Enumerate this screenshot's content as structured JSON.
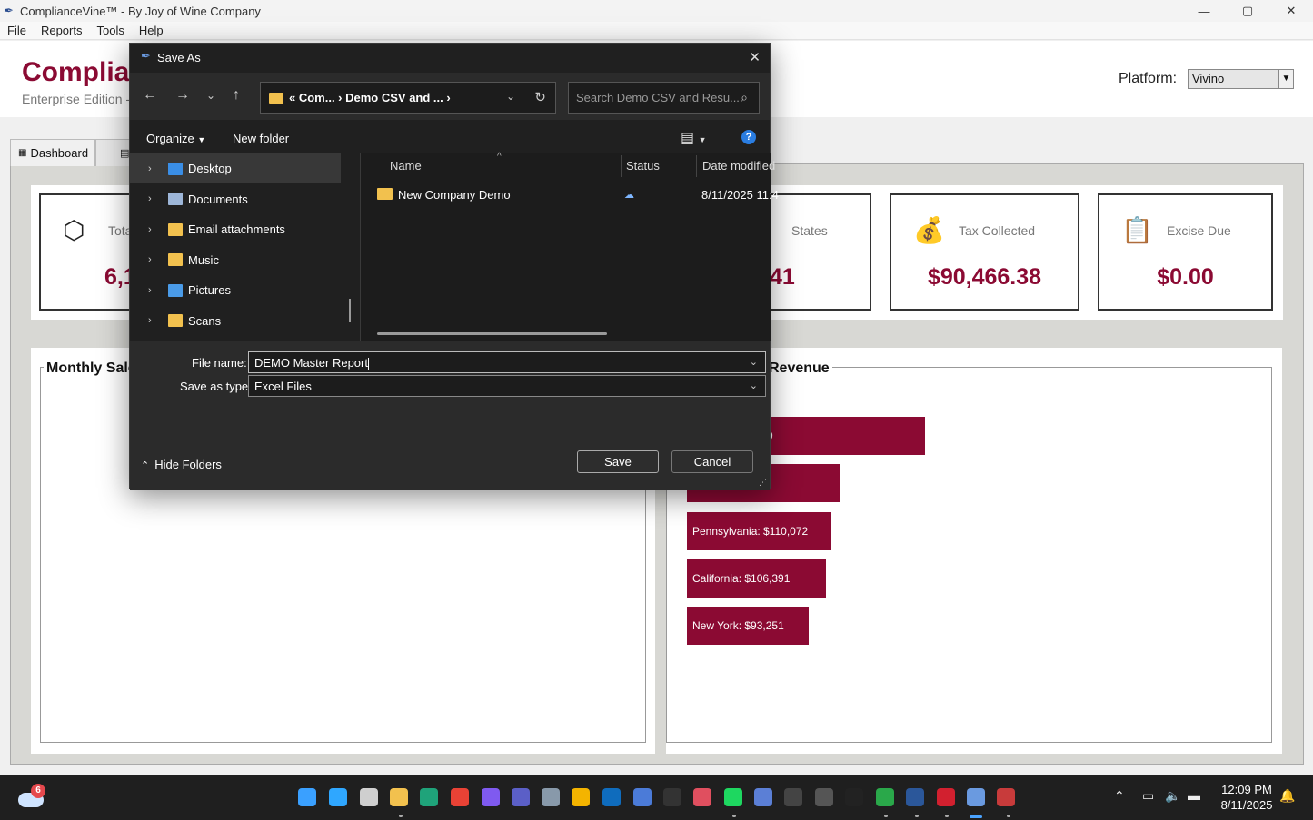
{
  "window": {
    "title": "ComplianceVine™ - By Joy of Wine Company",
    "minimize": "—",
    "maximize": "▢",
    "close": "✕"
  },
  "menu": [
    "File",
    "Reports",
    "Tools",
    "Help"
  ],
  "header": {
    "brand": "Complian",
    "edition": "Enterprise Edition -",
    "platform_label": "Platform:",
    "platform_value": "Vivino"
  },
  "tabs": [
    {
      "label": "Dashboard"
    }
  ],
  "kpis": [
    {
      "label": "Tota",
      "value": "6,1",
      "icon": "package-icon"
    },
    {
      "label": "States",
      "value": "41",
      "icon": ""
    },
    {
      "label": "Tax Collected",
      "value": "$90,466.38",
      "icon": "money-bag-icon"
    },
    {
      "label": "Excise Due",
      "value": "$0.00",
      "icon": "clipboard-icon"
    }
  ],
  "panels": {
    "left_title": "Monthly Sale",
    "right_title": "Revenue"
  },
  "chart_data": {
    "type": "bar",
    "orientation": "horizontal",
    "title": "",
    "categories": [
      "",
      "",
      "Pennsylvania",
      "California",
      "New York"
    ],
    "values": [
      null,
      null,
      110072,
      106391,
      93251
    ],
    "labels": [
      "9",
      "",
      "Pennsylvania: $110,072",
      "California: $106,391",
      "New York: $93,251"
    ],
    "bar_color": "#8b0a33"
  },
  "dialog": {
    "title": "Save As",
    "address_crumbs": "« Com...  ›  Demo CSV and ...  ›",
    "search_placeholder": "Search Demo CSV and Resu...",
    "organize": "Organize",
    "new_folder": "New folder",
    "help": "?",
    "nav_items": [
      {
        "label": "Desktop",
        "color": "#3a8ee6",
        "selected": true
      },
      {
        "label": "Documents",
        "color": "#9db6d8",
        "selected": false
      },
      {
        "label": "Email attachments",
        "color": "#f2c14e",
        "selected": false
      },
      {
        "label": "Music",
        "color": "#f2c14e",
        "selected": false
      },
      {
        "label": "Pictures",
        "color": "#4a9be8",
        "selected": false
      },
      {
        "label": "Scans",
        "color": "#f2c14e",
        "selected": false
      }
    ],
    "columns": {
      "name": "Name",
      "status": "Status",
      "date": "Date modified"
    },
    "files": [
      {
        "name": "New Company Demo",
        "date": "8/11/2025 11:4"
      }
    ],
    "file_name_label": "File name:",
    "file_name_value": "DEMO Master Report",
    "save_type_label": "Save as type:",
    "save_type_value": "Excel Files",
    "hide_folders": "Hide Folders",
    "save": "Save",
    "cancel": "Cancel"
  },
  "taskbar": {
    "weather_badge": "6",
    "time": "12:09 PM",
    "date": "8/11/2025"
  }
}
